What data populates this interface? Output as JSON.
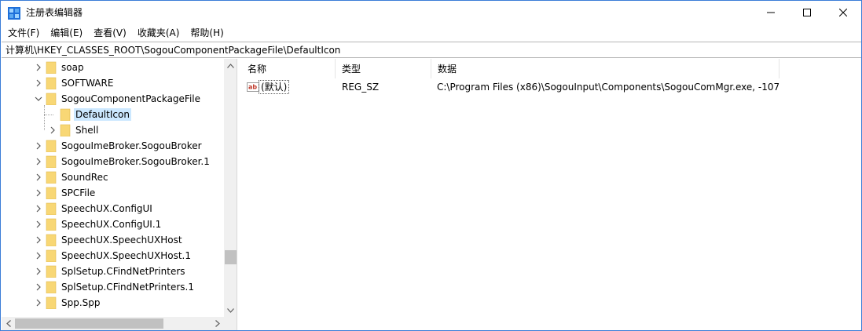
{
  "window": {
    "title": "注册表编辑器",
    "controls": {
      "minimize": "minimize",
      "maximize": "maximize",
      "close": "close"
    }
  },
  "menu": [
    "文件(F)",
    "编辑(E)",
    "查看(V)",
    "收藏夹(A)",
    "帮助(H)"
  ],
  "address": "计算机\\HKEY_CLASSES_ROOT\\SogouComponentPackageFile\\DefaultIcon",
  "tree": {
    "items": [
      {
        "label": "soap",
        "level": 0,
        "expander": "collapsed"
      },
      {
        "label": "SOFTWARE",
        "level": 0,
        "expander": "collapsed"
      },
      {
        "label": "SogouComponentPackageFile",
        "level": 0,
        "expander": "expanded"
      },
      {
        "label": "DefaultIcon",
        "level": 1,
        "expander": "none",
        "selected": true
      },
      {
        "label": "Shell",
        "level": 1,
        "expander": "collapsed"
      },
      {
        "label": "SogouImeBroker.SogouBroker",
        "level": 0,
        "expander": "collapsed"
      },
      {
        "label": "SogouImeBroker.SogouBroker.1",
        "level": 0,
        "expander": "collapsed"
      },
      {
        "label": "SoundRec",
        "level": 0,
        "expander": "collapsed"
      },
      {
        "label": "SPCFile",
        "level": 0,
        "expander": "collapsed"
      },
      {
        "label": "SpeechUX.ConfigUI",
        "level": 0,
        "expander": "collapsed"
      },
      {
        "label": "SpeechUX.ConfigUI.1",
        "level": 0,
        "expander": "collapsed"
      },
      {
        "label": "SpeechUX.SpeechUXHost",
        "level": 0,
        "expander": "collapsed"
      },
      {
        "label": "SpeechUX.SpeechUXHost.1",
        "level": 0,
        "expander": "collapsed"
      },
      {
        "label": "SplSetup.CFindNetPrinters",
        "level": 0,
        "expander": "collapsed"
      },
      {
        "label": "SplSetup.CFindNetPrinters.1",
        "level": 0,
        "expander": "collapsed"
      },
      {
        "label": "Spp.Spp",
        "level": 0,
        "expander": "collapsed"
      }
    ]
  },
  "list": {
    "columns": [
      "名称",
      "类型",
      "数据"
    ],
    "rows": [
      {
        "name": "(默认)",
        "type": "REG_SZ",
        "data": "C:\\Program Files (x86)\\SogouInput\\Components\\SogouComMgr.exe, -107",
        "icon": "string-value-icon"
      }
    ]
  },
  "colors": {
    "folder": "#f8d775",
    "selection": "#cce8ff",
    "border_accent": "#3b7dd8"
  }
}
